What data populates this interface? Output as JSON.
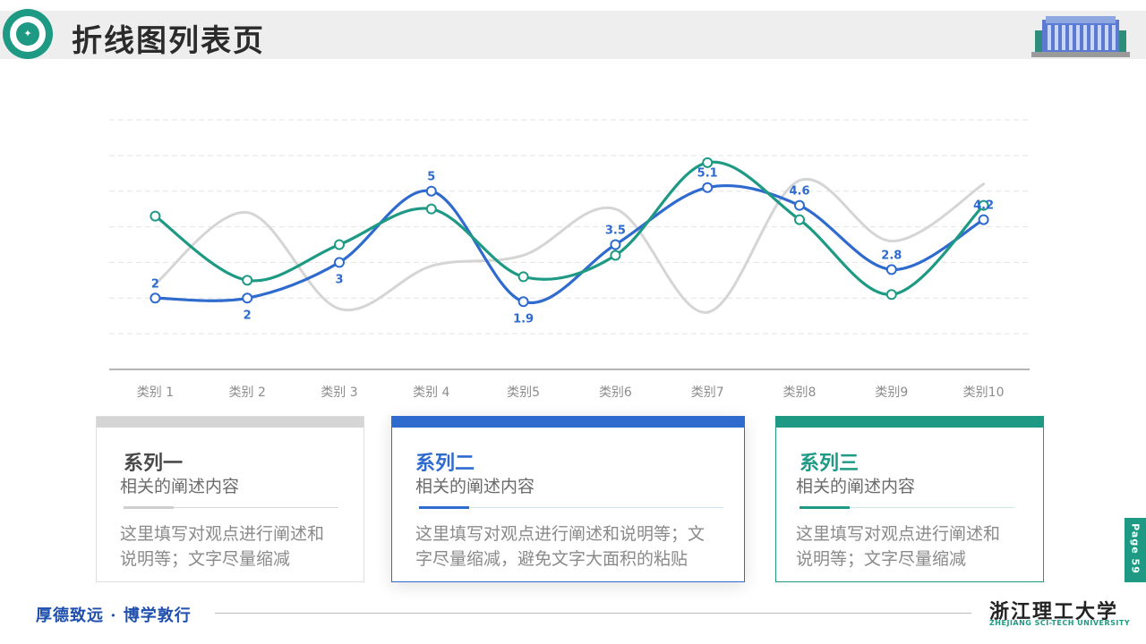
{
  "header": {
    "title": "折线图列表页",
    "logo_icon": "university-seal-icon",
    "building_icon": "campus-building-icon"
  },
  "colors": {
    "series1": "#d5d5d5",
    "series2": "#2f6bce",
    "series3": "#1e9a84",
    "accent": "#1e9a84",
    "motto": "#1f4fae"
  },
  "chart_data": {
    "type": "line",
    "smooth": true,
    "categories": [
      "类别 1",
      "类别 2",
      "类别 3",
      "类别 4",
      "类别5",
      "类别6",
      "类别7",
      "类别8",
      "类别9",
      "类别10"
    ],
    "ylim": [
      0,
      7
    ],
    "grid": true,
    "series": [
      {
        "name": "系列一",
        "values": [
          2.4,
          4.4,
          1.7,
          2.9,
          3.2,
          4.5,
          1.6,
          5.3,
          3.6,
          5.2
        ],
        "markers": false,
        "labels": false
      },
      {
        "name": "系列二",
        "values": [
          2,
          2,
          3,
          5,
          1.9,
          3.5,
          5.1,
          4.6,
          2.8,
          4.2
        ],
        "markers": true,
        "labels": true
      },
      {
        "name": "系列三",
        "values": [
          4.3,
          2.5,
          3.5,
          4.5,
          2.6,
          3.2,
          5.8,
          4.2,
          2.1,
          4.6
        ],
        "markers": true,
        "labels": false
      }
    ]
  },
  "cards": [
    {
      "title": "系列一",
      "subtitle": "相关的阐述内容",
      "body": [
        "这里填写对观点进行阐述和",
        "说明等；文字尽量缩减"
      ]
    },
    {
      "title": "系列二",
      "subtitle": "相关的阐述内容",
      "body": [
        "这里填写对观点进行阐述和说明等；文",
        "字尽量缩减，避免文字大面积的粘贴"
      ]
    },
    {
      "title": "系列三",
      "subtitle": "相关的阐述内容",
      "body": [
        "这里填写对观点进行阐述和",
        "说明等；文字尽量缩减"
      ]
    }
  ],
  "footer": {
    "motto": "厚德致远 · 博学敦行",
    "university_cn": "浙江理工大学",
    "university_en": "ZHEJIANG SCI-TECH UNIVERSITY",
    "page_label": "Page 59"
  }
}
